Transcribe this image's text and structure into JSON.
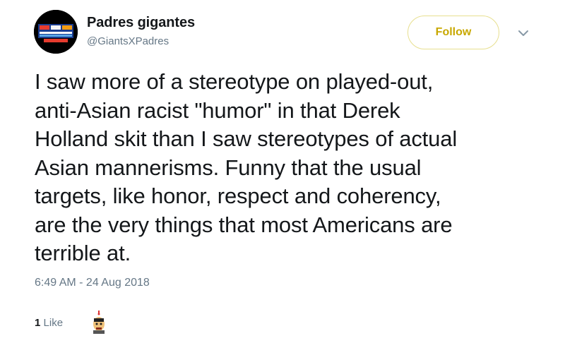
{
  "user": {
    "display_name": "Padres gigantes",
    "handle": "@GiantsXPadres"
  },
  "actions": {
    "follow_label": "Follow",
    "menu_icon": "chevron-down-icon"
  },
  "tweet": {
    "lines": [
      "I saw more of a stereotype on played-out,",
      "anti-Asian racist \"humor\" in that Derek",
      "Holland skit than I saw stereotypes of actual",
      "Asian mannerisms. Funny that the usual",
      "targets, like honor, respect and coherency,",
      "are the very things that most Americans are",
      "terrible at."
    ],
    "timestamp": "6:49 AM - 24 Aug 2018"
  },
  "engagement": {
    "like_count": "1",
    "like_label": "Like"
  },
  "colors": {
    "follow_text": "#c8a800",
    "follow_border": "#e7df8f",
    "secondary_text": "#657786",
    "primary_text": "#14171a"
  }
}
